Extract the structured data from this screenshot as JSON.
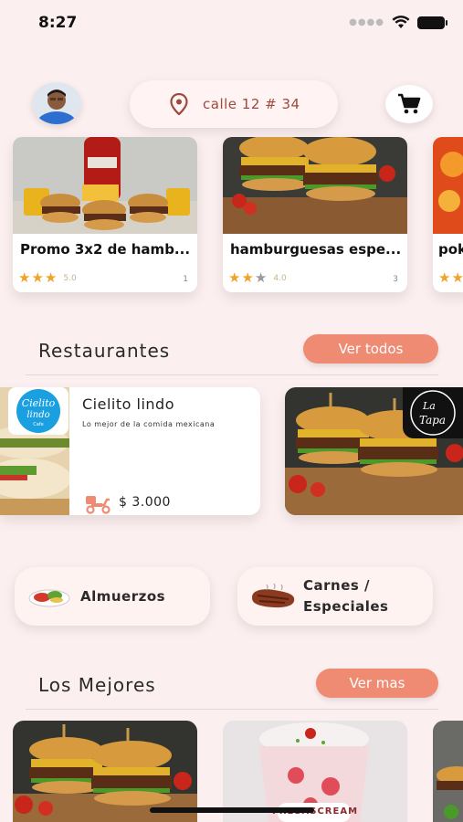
{
  "status_bar": {
    "time": "8:27"
  },
  "header": {
    "location": "calle 12 # 34",
    "avatar_icon": "user-avatar",
    "pin_icon": "location-pin-icon",
    "cart_icon": "cart-icon"
  },
  "promos": [
    {
      "title": "Promo 3x2 de hamb...",
      "stars_on": 3,
      "rating": "5.0",
      "count": "1"
    },
    {
      "title": "hamburguesas espe...",
      "stars_on": 2,
      "rating": "4.0",
      "count": "3"
    },
    {
      "title": "pok",
      "stars_on": 2,
      "rating": "",
      "count": ""
    }
  ],
  "restaurants_section": {
    "title": "Restaurantes",
    "button": "Ver todos"
  },
  "restaurants": [
    {
      "logo_line1": "Cielito",
      "logo_line2": "lindo",
      "logo_line3": "Cafe",
      "name": "Cielito lindo",
      "description": "Lo mejor de la comida mexicana",
      "price": "$ 3.000"
    },
    {
      "logo_line1": "La",
      "logo_line2": "Tapa"
    }
  ],
  "categories": [
    {
      "label": "Almuerzos",
      "icon": "lunch-plate-icon"
    },
    {
      "label_line1": "Carnes /",
      "label_line2": "Especiales",
      "icon": "steak-icon"
    }
  ],
  "best_section": {
    "title": "Los Mejores",
    "button": "Ver mas"
  },
  "best_items": [
    {
      "caption": ""
    },
    {
      "caption": "FRESASCREAM"
    }
  ],
  "colors": {
    "accent": "#ef8a73",
    "background": "#fcefef",
    "star": "#f0a22a"
  }
}
